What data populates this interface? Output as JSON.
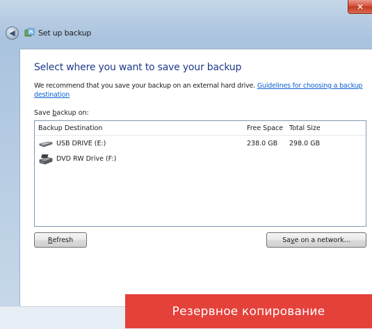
{
  "window": {
    "title": "Set up backup",
    "close_glyph": "✕",
    "back_glyph": "◀"
  },
  "content": {
    "heading": "Select where you want to save your backup",
    "recommend_text": "We recommend that you save your backup on an external hard drive.",
    "recommend_link": "Guidelines for choosing a backup destination",
    "save_label_prefix": "Save ",
    "save_label_accel": "b",
    "save_label_suffix": "ackup on:"
  },
  "list": {
    "headers": {
      "destination": "Backup Destination",
      "free": "Free Space",
      "total": "Total Size"
    },
    "rows": [
      {
        "name": "USB DRIVE (E:)",
        "free": "238.0 GB",
        "total": "298.0 GB",
        "icon": "usb-drive-icon"
      },
      {
        "name": "DVD RW Drive (F:)",
        "free": "",
        "total": "",
        "icon": "dvd-drive-icon"
      }
    ]
  },
  "buttons": {
    "refresh_accel": "R",
    "refresh_rest": "efresh",
    "network_prefix": "Sa",
    "network_accel": "v",
    "network_rest": "e on a network..."
  },
  "caption": "Резервное копирование",
  "colors": {
    "heading": "#1e3a8a",
    "link": "#0b5fd1",
    "caption_bg": "#e5413b",
    "close_btn": "#d4533c"
  }
}
